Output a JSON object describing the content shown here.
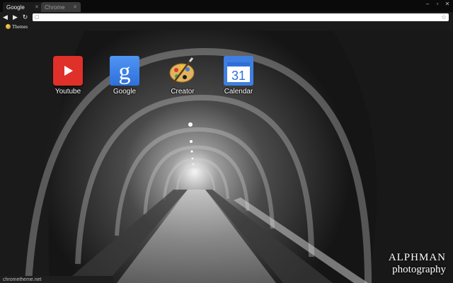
{
  "tabs": [
    {
      "title": "Google",
      "active": true
    },
    {
      "title": "Chrome",
      "active": false
    }
  ],
  "window_controls": [
    "minimize-icon",
    "maximize-icon",
    "close-icon"
  ],
  "toolbar": {
    "back_icon": "back-arrow-icon",
    "forward_icon": "forward-arrow-icon",
    "reload_icon": "reload-icon",
    "omnibox": {
      "value": "",
      "placeholder": ""
    },
    "star_icon": "star-icon"
  },
  "bookmarks": [
    {
      "label": "Themes",
      "icon": "theme-icon"
    }
  ],
  "apps": [
    {
      "label": "Youtube",
      "icon": "youtube-icon",
      "color": "#e0302a"
    },
    {
      "label": "Google",
      "icon": "google-icon",
      "color": "#3b82ee"
    },
    {
      "label": "Creator",
      "icon": "palette-icon",
      "color": "#d8a34a"
    },
    {
      "label": "Calendar",
      "icon": "calendar-icon",
      "color": "#3f7fe0",
      "day": "31"
    }
  ],
  "watermark": {
    "line1": "ALPHMAN",
    "line2": "photography"
  },
  "status": "chrometheme.net"
}
